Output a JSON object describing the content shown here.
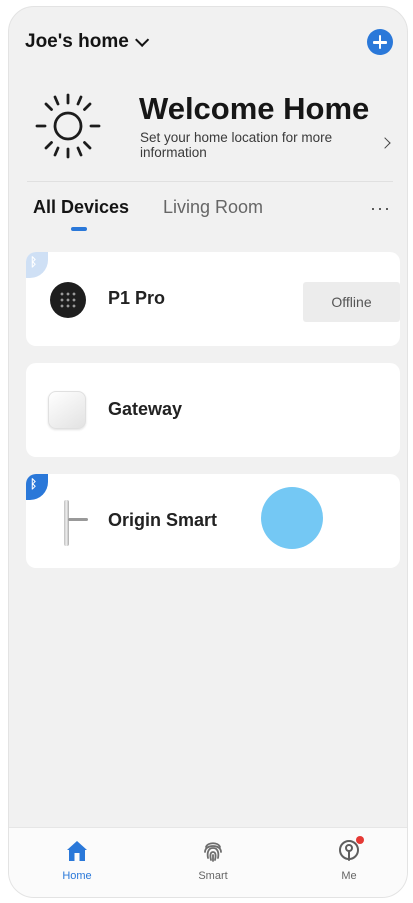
{
  "header": {
    "home_name": "Joe's  home",
    "home_dropdown_icon": "chevron-down-icon",
    "add_icon": "plus-circle-icon",
    "accent_color": "#2a78d9"
  },
  "welcome": {
    "title": "Welcome Home",
    "subtitle": "Set your home location for more information",
    "icon": "sun-icon",
    "arrow_icon": "chevron-right-icon"
  },
  "tabs": {
    "items": [
      {
        "label": "All Devices",
        "active": true
      },
      {
        "label": "Living Room",
        "active": false
      }
    ],
    "more_label": "···"
  },
  "devices": [
    {
      "name": "P1 Pro",
      "status": "Offline",
      "icon": "keypad-lock-icon",
      "bluetooth": true
    },
    {
      "name": "Gateway",
      "icon": "gateway-icon",
      "bluetooth": false
    },
    {
      "name": "Origin Smart",
      "icon": "door-handle-lock-icon",
      "bluetooth": true
    }
  ],
  "bottom_nav": {
    "items": [
      {
        "label": "Home",
        "icon": "home-icon",
        "active": true
      },
      {
        "label": "Smart",
        "icon": "fingerprint-icon",
        "active": false
      },
      {
        "label": "Me",
        "icon": "profile-icon",
        "active": false,
        "notification_dot": true
      }
    ]
  }
}
